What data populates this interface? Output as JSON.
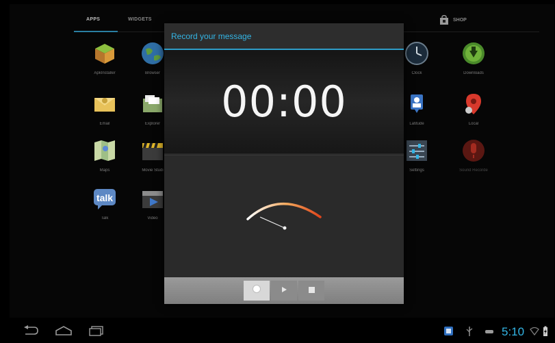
{
  "launcher": {
    "tabs": [
      {
        "label": "APPS"
      },
      {
        "label": "WIDGETS"
      }
    ],
    "shop_label": "SHOP",
    "apps": [
      {
        "label": "ApkInstaller",
        "icon": "package-icon"
      },
      {
        "label": "Browser",
        "icon": "globe-icon"
      },
      {
        "label": "Clock",
        "icon": "clock-icon"
      },
      {
        "label": "Downloads",
        "icon": "download-icon"
      },
      {
        "label": "Email",
        "icon": "envelope-icon"
      },
      {
        "label": "Explorer",
        "icon": "folder-icon"
      },
      {
        "label": "Latitude",
        "icon": "latitude-icon"
      },
      {
        "label": "Local",
        "icon": "map-pin-icon"
      },
      {
        "label": "Maps",
        "icon": "map-icon"
      },
      {
        "label": "Movie Studi",
        "icon": "clapperboard-icon"
      },
      {
        "label": "Settings",
        "icon": "settings-sliders-icon"
      },
      {
        "label": "Sound Recorde",
        "icon": "microphone-icon"
      },
      {
        "label": "Talk",
        "icon": "talk-icon"
      },
      {
        "label": "Video",
        "icon": "video-icon"
      }
    ]
  },
  "dialog": {
    "title": "Record your message",
    "timer": "00:00",
    "level_meter": {
      "level": 0.0
    },
    "controls": [
      {
        "name": "record",
        "icon": "record-icon",
        "active": true
      },
      {
        "name": "play",
        "icon": "play-icon",
        "active": false
      },
      {
        "name": "stop",
        "icon": "stop-icon",
        "active": false
      }
    ]
  },
  "status_bar": {
    "time": "5:10"
  },
  "colors": {
    "accent": "#33b5e5",
    "meter_hot": "#e0451b",
    "meter_warm": "#f2a65a"
  }
}
